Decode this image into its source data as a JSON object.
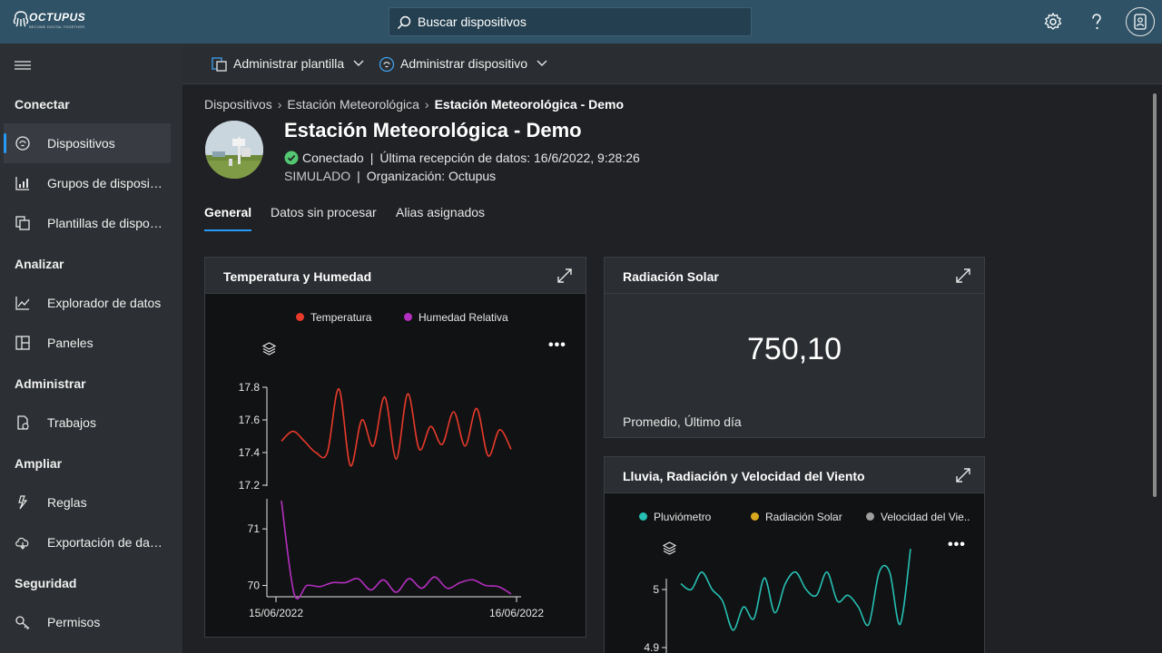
{
  "brand": {
    "name": "OCTUPUS",
    "tagline": "BECOME DIGITAL TOGETHER"
  },
  "search": {
    "placeholder": "Buscar dispositivos"
  },
  "topbar_icons": [
    "settings-icon",
    "help-icon",
    "user-avatar-icon"
  ],
  "sidebar": {
    "sections": [
      {
        "title": "Conectar",
        "items": [
          {
            "label": "Dispositivos",
            "icon": "devices-icon",
            "active": true
          },
          {
            "label": "Grupos de dispositivos",
            "icon": "device-groups-icon"
          },
          {
            "label": "Plantillas de dispositivos",
            "icon": "device-templates-icon"
          }
        ]
      },
      {
        "title": "Analizar",
        "items": [
          {
            "label": "Explorador de datos",
            "icon": "data-explorer-icon"
          },
          {
            "label": "Paneles",
            "icon": "dashboards-icon"
          }
        ]
      },
      {
        "title": "Administrar",
        "items": [
          {
            "label": "Trabajos",
            "icon": "jobs-icon"
          }
        ]
      },
      {
        "title": "Ampliar",
        "items": [
          {
            "label": "Reglas",
            "icon": "rules-icon"
          },
          {
            "label": "Exportación de datos",
            "icon": "data-export-icon"
          }
        ]
      },
      {
        "title": "Seguridad",
        "items": [
          {
            "label": "Permisos",
            "icon": "permissions-icon"
          }
        ]
      }
    ]
  },
  "commands": [
    {
      "label": "Administrar plantilla",
      "icon": "template-icon"
    },
    {
      "label": "Administrar dispositivo",
      "icon": "device-manage-icon"
    }
  ],
  "breadcrumb": [
    "Dispositivos",
    "Estación Meteorológica",
    "Estación Meteorológica - Demo"
  ],
  "device": {
    "title": "Estación Meteorológica - Demo",
    "status": "Conectado",
    "last_data": "Última recepción de datos: 16/6/2022, 9:28:26",
    "mode": "SIMULADO",
    "organization": "Organización: Octupus"
  },
  "tabs": [
    {
      "label": "General",
      "active": true
    },
    {
      "label": "Datos sin procesar"
    },
    {
      "label": "Alias asignados"
    }
  ],
  "cards": {
    "temp_hum": {
      "title": "Temperatura y Humedad"
    },
    "solar": {
      "title": "Radiación Solar",
      "value": "750,10",
      "subtitle": "Promedio, Último día"
    },
    "rain": {
      "title": "Lluvia, Radiación y Velocidad del Viento"
    }
  },
  "chart_data": [
    {
      "type": "line",
      "title": "Temperatura y Humedad",
      "x_range": [
        "15/06/2022",
        "16/06/2022"
      ],
      "x_tick_labels": [
        "15/06/2022",
        "16/06/2022"
      ],
      "series": [
        {
          "name": "Temperatura",
          "color": "#e83a2b",
          "ylim": [
            17.2,
            17.8
          ],
          "y_ticks": [
            "17.8",
            "17.6",
            "17.4",
            "17.2"
          ],
          "values": [
            17.47,
            17.53,
            17.47,
            17.4,
            17.4,
            17.79,
            17.32,
            17.6,
            17.44,
            17.74,
            17.36,
            17.76,
            17.42,
            17.56,
            17.45,
            17.65,
            17.44,
            17.67,
            17.38,
            17.54,
            17.42
          ]
        },
        {
          "name": "Humedad Relativa",
          "color": "#b42fc0",
          "ylim": [
            69.8,
            71.5
          ],
          "y_ticks": [
            "71",
            "70"
          ],
          "values": [
            71.5,
            69.85,
            70.0,
            69.98,
            70.05,
            70.05,
            70.12,
            69.92,
            70.1,
            69.88,
            70.12,
            69.95,
            70.15,
            69.95,
            70.05,
            70.1,
            70.0,
            69.98,
            69.85
          ]
        }
      ]
    },
    {
      "type": "line",
      "title": "Lluvia, Radiación y Velocidad del Viento",
      "legend": [
        {
          "name": "Pluviómetro",
          "color": "#26c0b4"
        },
        {
          "name": "Radiación Solar",
          "color": "#d9a81e"
        },
        {
          "name": "Velocidad del Viento",
          "label": "Velocidad del Vie..",
          "color": "#9e9e9e"
        }
      ],
      "y_ticks": [
        "5",
        "4.9"
      ],
      "ylim": [
        4.9,
        5.1
      ],
      "series": [
        {
          "name": "Pluviómetro",
          "color": "#26c0b4",
          "values": [
            5.01,
            5.0,
            5.03,
            5.0,
            4.98,
            4.93,
            4.97,
            4.95,
            5.02,
            4.96,
            5.01,
            5.03,
            5.0,
            4.99,
            5.03,
            4.98,
            4.99,
            4.97,
            4.94,
            5.03,
            5.03,
            4.94,
            5.07
          ]
        }
      ]
    }
  ]
}
